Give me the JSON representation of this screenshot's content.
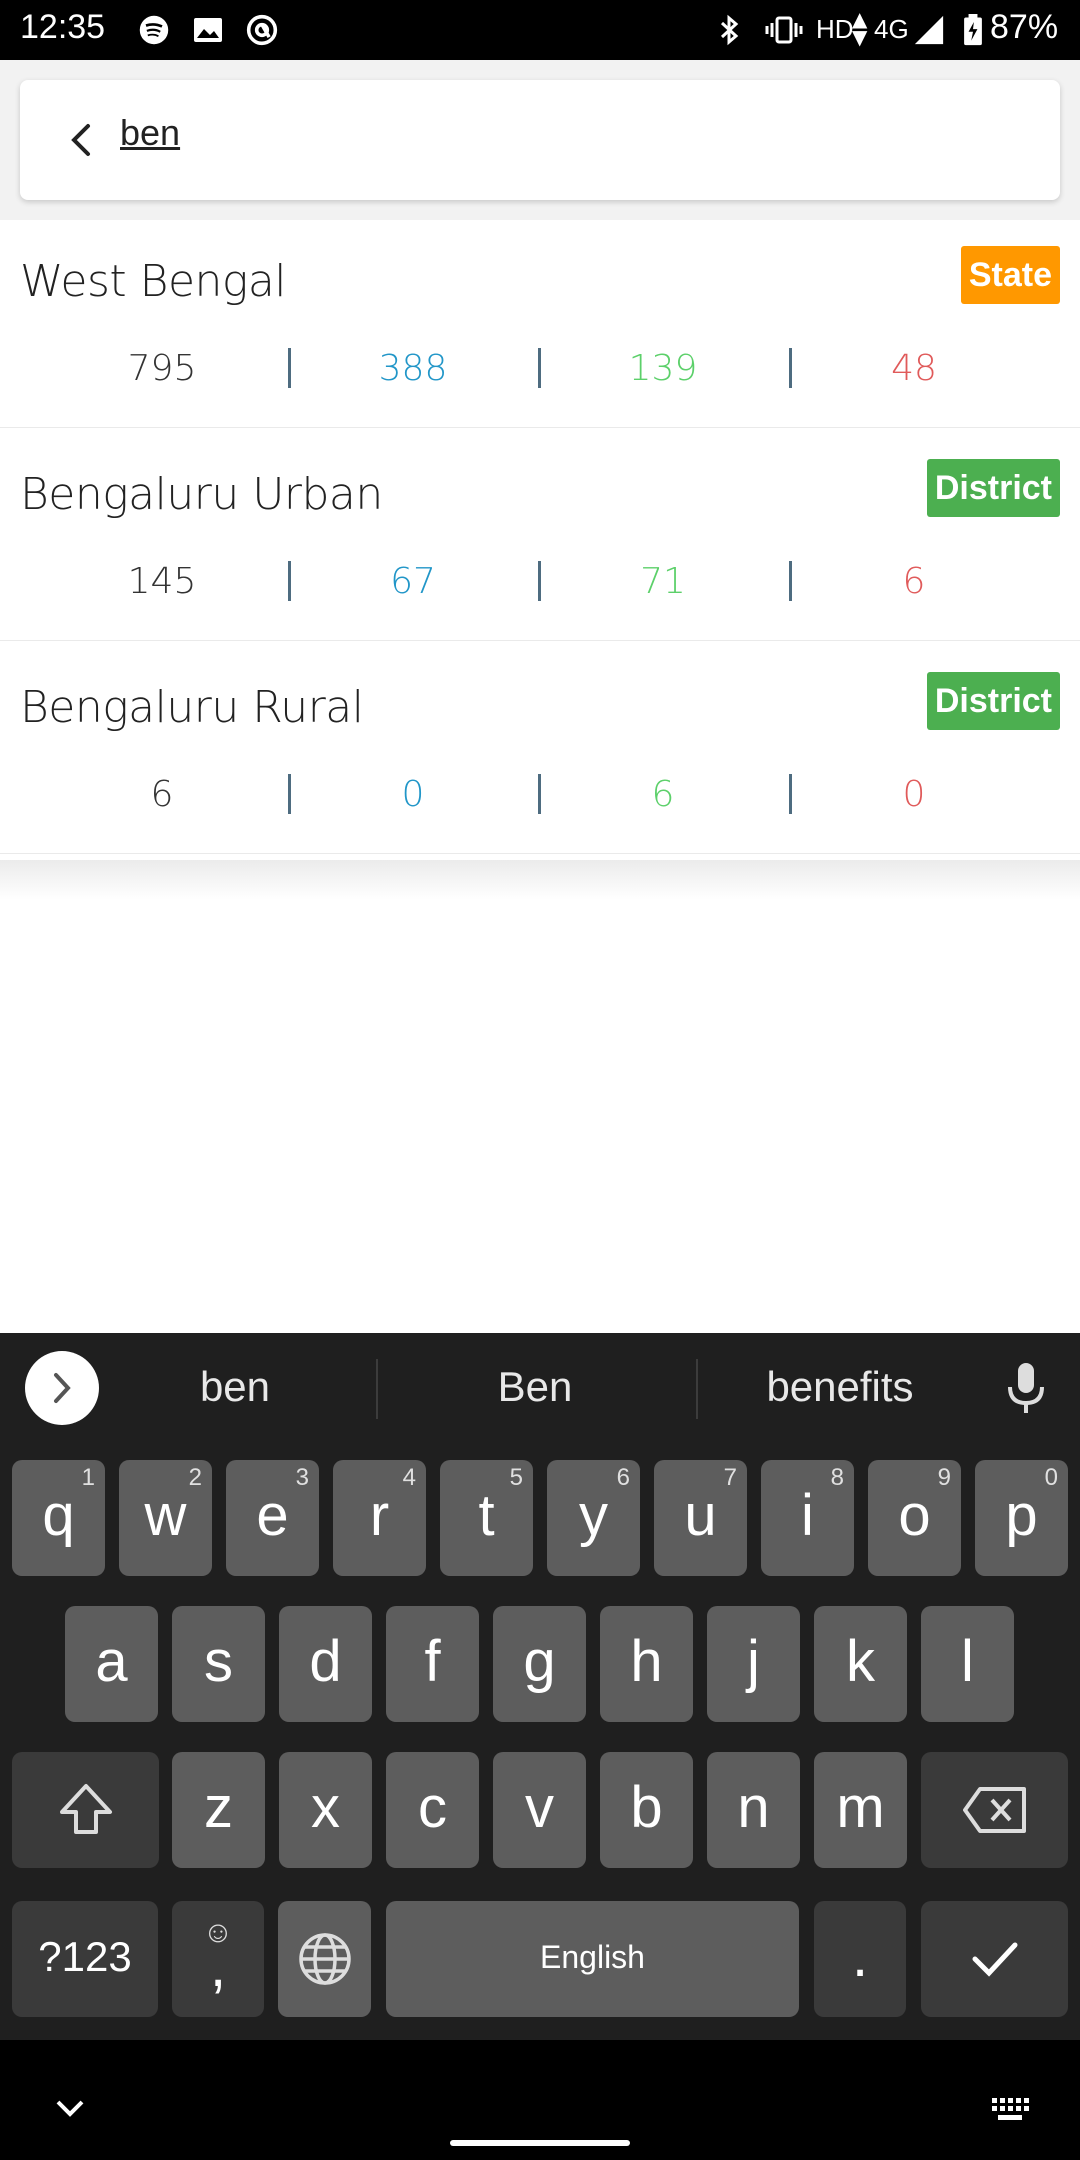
{
  "status_bar": {
    "time": "12:35",
    "network": "HD",
    "signal": "4G",
    "battery": "87%"
  },
  "search": {
    "query": "ben"
  },
  "results": [
    {
      "name": "West Bengal",
      "type": "State",
      "type_color": "#ff9800",
      "confirmed": "795",
      "active": "388",
      "recovered": "139",
      "deceased": "48"
    },
    {
      "name": "Bengaluru Urban",
      "type": "District",
      "type_color": "#4caf50",
      "confirmed": "145",
      "active": "67",
      "recovered": "71",
      "deceased": "6"
    },
    {
      "name": "Bengaluru Rural",
      "type": "District",
      "type_color": "#4caf50",
      "confirmed": "6",
      "active": "0",
      "recovered": "6",
      "deceased": "0"
    }
  ],
  "colors": {
    "confirmed": "#333333",
    "active": "#2196c8",
    "recovered": "#5cd06a",
    "deceased": "#e05a5a"
  },
  "keyboard": {
    "suggestions": [
      "ben",
      "Ben",
      "benefits"
    ],
    "row1": [
      {
        "key": "q",
        "hint": "1"
      },
      {
        "key": "w",
        "hint": "2"
      },
      {
        "key": "e",
        "hint": "3"
      },
      {
        "key": "r",
        "hint": "4"
      },
      {
        "key": "t",
        "hint": "5"
      },
      {
        "key": "y",
        "hint": "6"
      },
      {
        "key": "u",
        "hint": "7"
      },
      {
        "key": "i",
        "hint": "8"
      },
      {
        "key": "o",
        "hint": "9"
      },
      {
        "key": "p",
        "hint": "0"
      }
    ],
    "row2": [
      "a",
      "s",
      "d",
      "f",
      "g",
      "h",
      "j",
      "k",
      "l"
    ],
    "row3": [
      "z",
      "x",
      "c",
      "v",
      "b",
      "n",
      "m"
    ],
    "symbols_label": "?123",
    "comma_label": ",",
    "space_label": "English",
    "period_label": "."
  }
}
